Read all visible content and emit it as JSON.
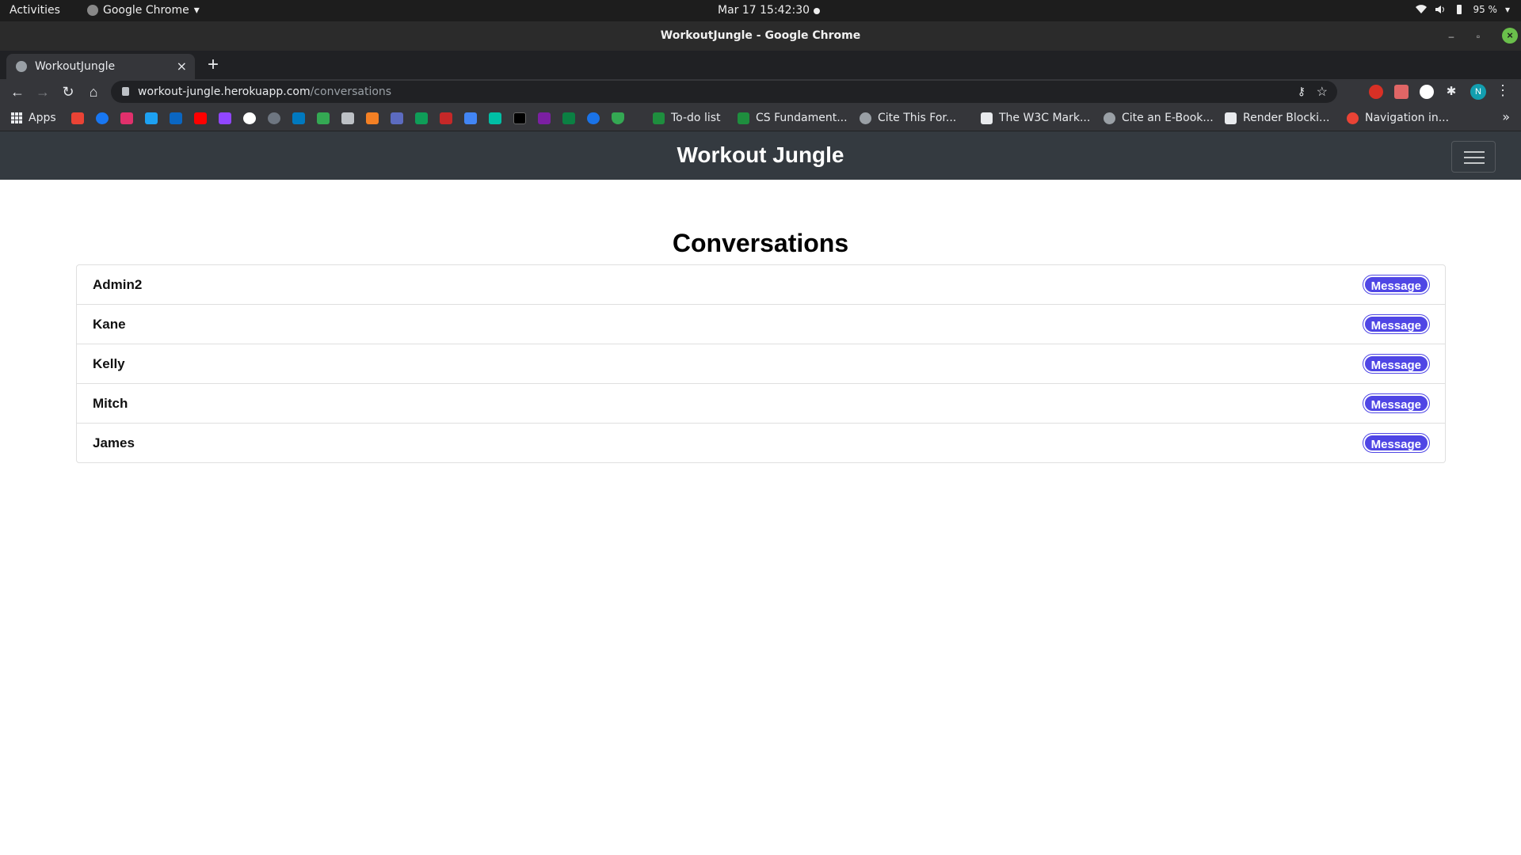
{
  "os_bar": {
    "activities": "Activities",
    "app_name": "Google Chrome",
    "datetime": "Mar 17  15:42:30",
    "battery": "95 %"
  },
  "window": {
    "title": "WorkoutJungle - Google Chrome"
  },
  "tab": {
    "label": "WorkoutJungle",
    "close": "×",
    "new_tab": "+"
  },
  "address_bar": {
    "host": "workout-jungle.herokuapp.com",
    "path": "/conversations"
  },
  "bookmarks": {
    "apps": "Apps",
    "items": [
      {
        "label": "To-do list",
        "color": "#1e8e3e"
      },
      {
        "label": "CS Fundament...",
        "color": "#1e8e3e"
      },
      {
        "label": "Cite This For...",
        "color": "#9aa0a6"
      },
      {
        "label": "The W3C Mark...",
        "color": "#e8eaed"
      },
      {
        "label": "Cite an E-Book...",
        "color": "#9aa0a6"
      },
      {
        "label": "Render Blocki...",
        "color": "#e8eaed"
      },
      {
        "label": "Navigation in...",
        "color": "#ea4335"
      }
    ],
    "more": "»"
  },
  "site": {
    "brand": "Workout Jungle",
    "heading": "Conversations",
    "message_label": "Message",
    "conversations": [
      {
        "name": "Admin2"
      },
      {
        "name": "Kane"
      },
      {
        "name": "Kelly"
      },
      {
        "name": "Mitch"
      },
      {
        "name": "James"
      }
    ]
  },
  "colors": {
    "navbar": "#343a40",
    "message_badge": "#4f46e5"
  }
}
